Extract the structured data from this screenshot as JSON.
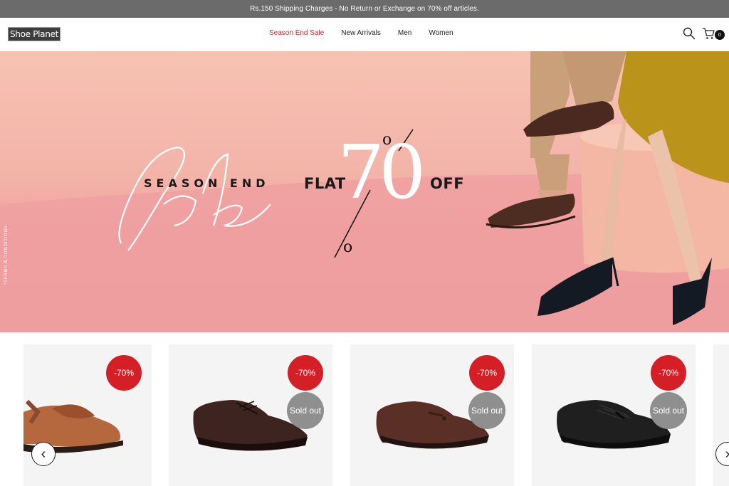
{
  "announcement": "Rs.150 Shipping Charges - No Return or Exchange on 70% off articles.",
  "header": {
    "logo": "Shoe Planet",
    "nav": [
      "Season End Sale",
      "New Arrivals",
      "Men",
      "Women"
    ],
    "cart_count": "0"
  },
  "hero": {
    "terms": "*TERMS & CONDITIONS",
    "line1": "SEASON END",
    "script": "Sale",
    "flat": "FLAT",
    "number": "70",
    "percent_top": "o",
    "percent_bottom": "o",
    "off": "OFF"
  },
  "products": {
    "items": [
      {
        "discount": "-70%",
        "sold_out": ""
      },
      {
        "discount": "-70%",
        "sold_out": "Sold out"
      },
      {
        "discount": "-70%",
        "sold_out": "Sold out"
      },
      {
        "discount": "-70%",
        "sold_out": "Sold out"
      }
    ],
    "prev": "‹",
    "next": "›"
  },
  "colors": {
    "accent": "#d41f26",
    "announcement_bg": "#6b6b6b",
    "sold_out": "#8f8f8f"
  }
}
